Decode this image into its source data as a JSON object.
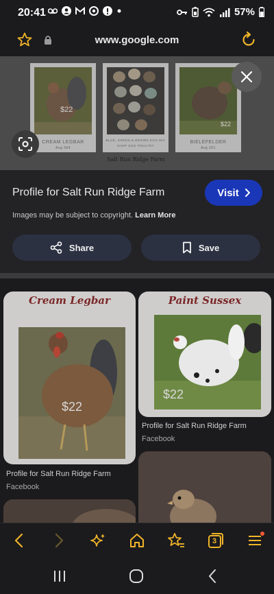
{
  "status": {
    "time": "20:41",
    "battery": "57%"
  },
  "browser": {
    "url": "www.google.com"
  },
  "preview": {
    "cards": [
      {
        "caption": "CREAM LEGBAR",
        "sub": "Avg 394",
        "price": "$22"
      },
      {
        "caption": "BLUE, GREEN & BROWN EGG MIX",
        "sub": "SHOP EGG POULTRY",
        "price": ""
      },
      {
        "caption": "BIELEFELDER",
        "sub": "Avg 201",
        "price": "$22"
      }
    ],
    "caption": "Salt Run Ridge Farm"
  },
  "info": {
    "title": "Profile for Salt Run Ridge Farm",
    "visit_label": "Visit",
    "copyright_text": "Images may be subject to copyright.",
    "learn_more": "Learn More",
    "share_label": "Share",
    "save_label": "Save"
  },
  "results": [
    {
      "heading": "Cream Legbar",
      "price": "$22",
      "title": "Profile for Salt Run Ridge Farm",
      "source": "Facebook"
    },
    {
      "heading": "Paint Sussex",
      "price": "$22",
      "title": "Profile for Salt Run Ridge Farm",
      "source": "Facebook"
    }
  ],
  "bottom_nav": {
    "tabs_count": "3"
  },
  "colors": {
    "accent": "#f0b429",
    "visit": "#1a37b8",
    "pill": "#2c3142",
    "notification_dot": "#ff5a36"
  },
  "icons": [
    "star-icon",
    "lock-icon",
    "reload-icon",
    "close-icon",
    "lens-icon",
    "share-icon",
    "bookmark-icon",
    "chevron-right-icon",
    "back-icon",
    "forward-icon",
    "sparkle-icon",
    "home-icon",
    "bookmarks-icon",
    "tabs-icon",
    "menu-icon"
  ]
}
